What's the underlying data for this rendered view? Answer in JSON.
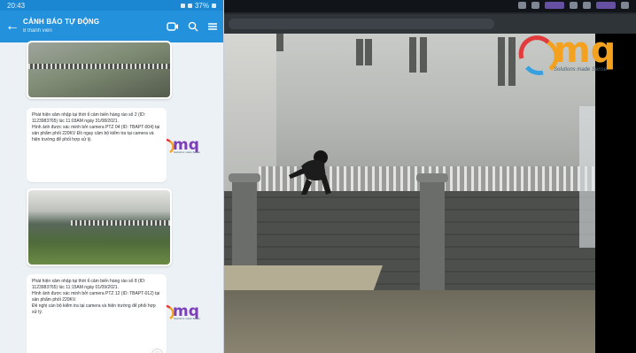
{
  "status_bar": {
    "time": "20:43",
    "battery": "37%"
  },
  "chat_header": {
    "title": "CẢNH BÁO TỰ ĐỘNG",
    "subtitle": "8 thành viên"
  },
  "messages": [
    {
      "text": "Phát hiện xâm nhập tại thời tỉ cảm biến hàng rào số 2 (ID: 1123983765) lúc 11:03AM ngày 31/08/2021.\nHình ảnh được xác minh bởi camera PTZ 04 (ID: TBAPT-004) tại sản phẩm phối 220KV Đồ ngay cảm bộ kiểm tra tại camera và hiện trường để phối hợp xử lý."
    },
    {
      "text": "Phát hiện xâm nhập tại thời tỉ cảm biến hàng rào số 8 (ID: 1123983765) lúc 11:15AM ngày 01/09/2021.\nHình ảnh được xác minh bởi camera PTZ 12 (ID: TBAPT-012) tại sản phẩm phối 220KV.\nĐề nghị cán bộ kiểm tra tại camera và hiện trường để phối hợp xử lý."
    }
  ],
  "logo": {
    "text": "mq",
    "tagline": "Solutions made Sense"
  },
  "colors": {
    "header": "#2391dc",
    "status": "#1b86d1",
    "logo_red": "#e23b3b",
    "logo_purple": "#7b3fb6",
    "logo_orange": "#f4a11f"
  }
}
